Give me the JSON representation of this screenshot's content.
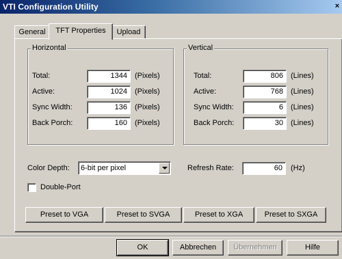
{
  "window": {
    "title": "VTI Configuration Utility",
    "close": "×"
  },
  "tabs": [
    "General",
    "TFT Properties",
    "Upload"
  ],
  "horizontal": {
    "legend": "Horizontal",
    "rows": [
      {
        "label": "Total:",
        "value": "1344",
        "unit": "(Pixels)"
      },
      {
        "label": "Active:",
        "value": "1024",
        "unit": "(Pixels)"
      },
      {
        "label": "Sync Width:",
        "value": "136",
        "unit": "(Pixels)"
      },
      {
        "label": "Back Porch:",
        "value": "160",
        "unit": "(Pixels)"
      }
    ]
  },
  "vertical": {
    "legend": "Vertical",
    "rows": [
      {
        "label": "Total:",
        "value": "806",
        "unit": "(Lines)"
      },
      {
        "label": "Active:",
        "value": "768",
        "unit": "(Lines)"
      },
      {
        "label": "Sync Width:",
        "value": "6",
        "unit": "(Lines)"
      },
      {
        "label": "Back Porch:",
        "value": "30",
        "unit": "(Lines)"
      }
    ]
  },
  "color_depth": {
    "label": "Color Depth:",
    "value": "6-bit per pixel"
  },
  "refresh": {
    "label": "Refresh Rate:",
    "value": "60",
    "unit": "(Hz)"
  },
  "double_port": {
    "label": "Double-Port",
    "checked": false
  },
  "presets": [
    "Preset to VGA",
    "Preset to SVGA",
    "Preset to XGA",
    "Preset to SXGA"
  ],
  "dialog_buttons": {
    "ok": "OK",
    "cancel": "Abbrechen",
    "apply": "Übernehmen",
    "help": "Hilfe"
  }
}
